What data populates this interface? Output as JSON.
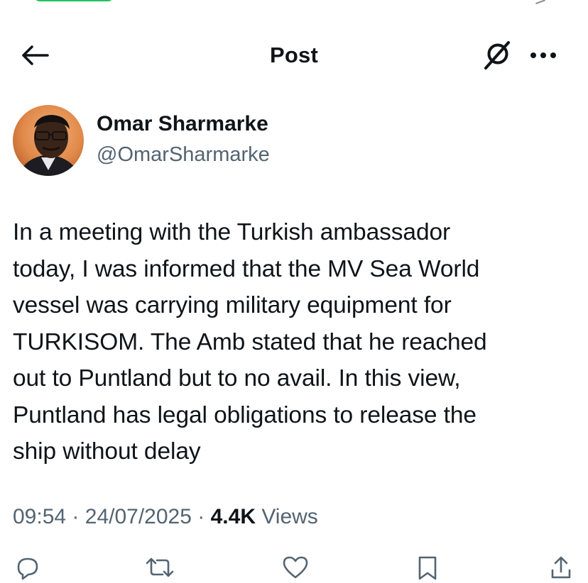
{
  "header": {
    "title": "Post",
    "back_icon": "arrow-left-icon",
    "grok_icon": "grok-icon",
    "more_icon": "more-dots-icon"
  },
  "author": {
    "display_name": "Omar Sharmarke",
    "handle": "@OmarSharmarke",
    "avatar_icon": "avatar"
  },
  "post": {
    "text": "In a meeting with the Turkish ambassador\ntoday, I was informed that the MV Sea World\nvessel was carrying military equipment for\nTURKISOM. The Amb stated that he reached\nout to Puntland but to no avail. In this view,\nPuntland has legal obligations to release the\nship without delay"
  },
  "meta": {
    "time": "09:54",
    "separator": "·",
    "date": "24/07/2025",
    "views_count": "4.4K",
    "views_label": "Views"
  },
  "actions": {
    "reply_icon": "reply-icon",
    "repost_icon": "repost-icon",
    "like_icon": "heart-icon",
    "bookmark_icon": "bookmark-icon",
    "share_icon": "share-icon"
  },
  "colors": {
    "text": "#0f1419",
    "secondary": "#536471",
    "status_green": "#22c55e"
  }
}
